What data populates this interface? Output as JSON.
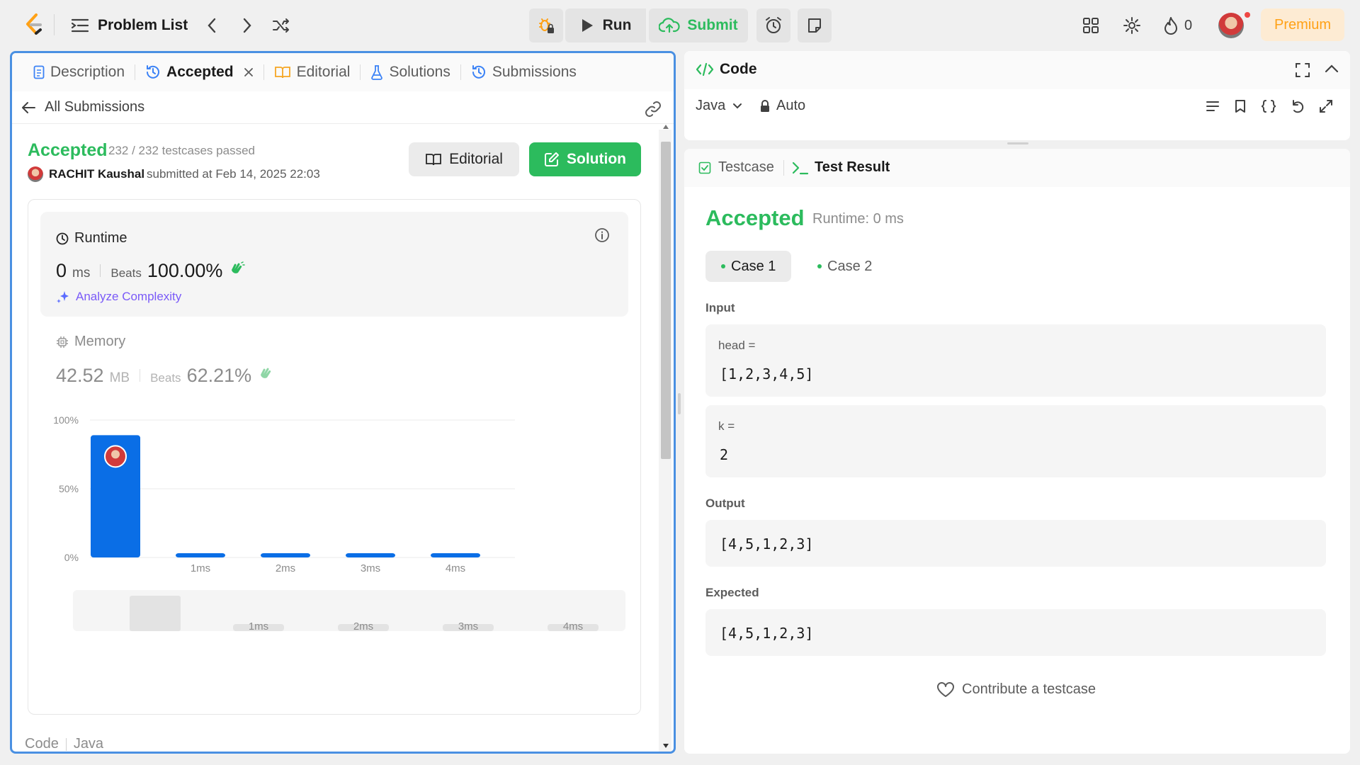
{
  "nav": {
    "problem_list": "Problem List",
    "run": "Run",
    "submit": "Submit",
    "streak": "0",
    "premium": "Premium"
  },
  "left": {
    "tabs": [
      {
        "label": "Description",
        "icon": "description-icon"
      },
      {
        "label": "Accepted",
        "icon": "history-icon"
      },
      {
        "label": "Editorial",
        "icon": "book-icon"
      },
      {
        "label": "Solutions",
        "icon": "flask-icon"
      },
      {
        "label": "Submissions",
        "icon": "history-icon"
      }
    ],
    "all_submissions": "All Submissions",
    "status": "Accepted",
    "testcases": "232 / 232 testcases passed",
    "user": "RACHIT Kaushal",
    "submitted_at": "submitted at Feb 14, 2025 22:03",
    "editorial_btn": "Editorial",
    "solution_btn": "Solution",
    "runtime": {
      "title": "Runtime",
      "value": "0",
      "unit": "ms",
      "beats_label": "Beats",
      "beats": "100.00%",
      "analyze": "Analyze Complexity"
    },
    "memory": {
      "title": "Memory",
      "value": "42.52",
      "unit": "MB",
      "beats_label": "Beats",
      "beats": "62.21%"
    },
    "code_label": "Code",
    "code_lang": "Java"
  },
  "chart_data": {
    "type": "bar",
    "categories": [
      "0ms",
      "1ms",
      "2ms",
      "3ms",
      "4ms"
    ],
    "category_labels": [
      "",
      "1ms",
      "2ms",
      "3ms",
      "4ms"
    ],
    "values": [
      89,
      1.5,
      1,
      1,
      1
    ],
    "yticks": [
      "100%",
      "50%",
      "0%"
    ],
    "ylim": [
      0,
      100
    ],
    "bar_color": "#0a6ee6",
    "highlight_index": 0,
    "minimap_labels": [
      "1ms",
      "2ms",
      "3ms",
      "4ms"
    ]
  },
  "right": {
    "code_title": "Code",
    "language": "Java",
    "autosave": "Auto",
    "testcase_tab": "Testcase",
    "result_tab": "Test Result",
    "result_status": "Accepted",
    "result_runtime": "Runtime: 0 ms",
    "cases": [
      "Case 1",
      "Case 2"
    ],
    "input_label": "Input",
    "inputs": [
      {
        "name": "head =",
        "value": "[1,2,3,4,5]"
      },
      {
        "name": "k =",
        "value": "2"
      }
    ],
    "output_label": "Output",
    "output": "[4,5,1,2,3]",
    "expected_label": "Expected",
    "expected": "[4,5,1,2,3]",
    "contribute": "Contribute a testcase"
  },
  "colors": {
    "accent_green": "#2cbb5d",
    "blue_bar": "#0a6ee6",
    "premium": "#ffa116",
    "focus_border": "#4a90e2"
  }
}
